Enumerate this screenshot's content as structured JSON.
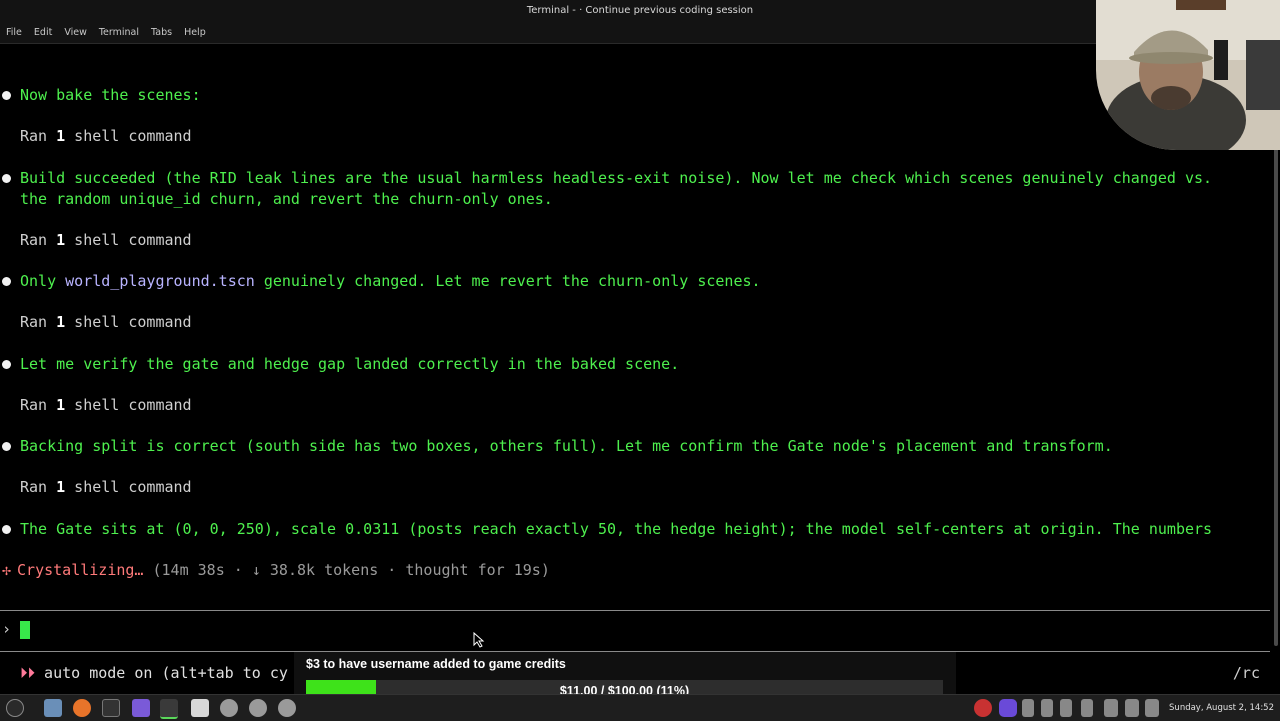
{
  "window": {
    "title": "Terminal - ·  Continue previous coding session",
    "menu": [
      "File",
      "Edit",
      "View",
      "Terminal",
      "Tabs",
      "Help"
    ]
  },
  "terminal": {
    "m1": "Now bake the scenes:",
    "r1_pre": "Ran ",
    "r1_num": "1",
    "r1_post": " shell command",
    "m2a": "Build succeeded (the RID leak lines are the usual harmless headless-exit noise). Now let me check which scenes genuinely changed vs.",
    "m2b": "the random unique_id churn, and revert the churn-only ones.",
    "r2_pre": "Ran ",
    "r2_num": "1",
    "r2_post": " shell command",
    "m3_pre": "Only ",
    "m3_file": "world_playground.tscn",
    "m3_post": " genuinely changed. Let me revert the churn-only scenes.",
    "r3_pre": "Ran ",
    "r3_num": "1",
    "r3_post": " shell command",
    "m4": "Let me verify the gate and hedge gap landed correctly in the baked scene.",
    "r4_pre": "Ran ",
    "r4_num": "1",
    "r4_post": " shell command",
    "m5": "Backing split is correct (south side has two boxes, others full). Let me confirm the Gate node's placement and transform.",
    "r5_pre": "Ran ",
    "r5_num": "1",
    "r5_post": " shell command",
    "m6": "The Gate sits at (0, 0, 250), scale 0.0311 (posts reach exactly 50, the hedge height); the model self-centers at origin. The numbers",
    "status_glyph": "✢",
    "status_word": "Crystallizing…",
    "status_meta": " (14m 38s · ↓ 38.8k tokens · thought for 19s)",
    "prompt": "›",
    "mode_arrows": "⏵⏵",
    "mode_text": " auto mode on (alt+tab to cy",
    "rc": "/rc"
  },
  "goal": {
    "title": "$3 to have username added to game credits",
    "label": "$11.00 / $100.00 (11%)",
    "progress": 0.11
  },
  "taskbar": {
    "clock": "Sunday, August  2, 14:52"
  },
  "colors": {
    "green": "#4ef04e",
    "progress": "#3ee21a"
  }
}
